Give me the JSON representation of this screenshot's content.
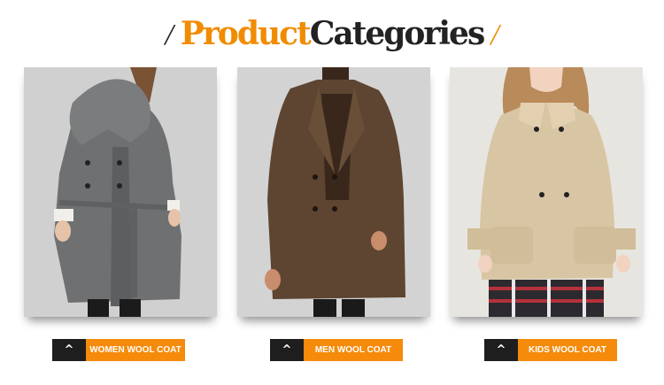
{
  "header": {
    "title_part1": "Product",
    "title_part2": "Categories",
    "slash_left": "/",
    "slash_right": "/"
  },
  "categories": [
    {
      "label": "WOMEN WOOL COAT",
      "arrow": "^",
      "image": "woman-grey-wool-coat"
    },
    {
      "label": "MEN WOOL COAT",
      "arrow": "^",
      "image": "man-brown-wool-coat"
    },
    {
      "label": "KIDS WOOL COAT",
      "arrow": "^",
      "image": "girl-beige-wool-coat"
    }
  ],
  "colors": {
    "accent": "#f08c00",
    "button_orange": "#f58a0b",
    "button_dark": "#1e1e1e",
    "text_dark": "#222222"
  }
}
